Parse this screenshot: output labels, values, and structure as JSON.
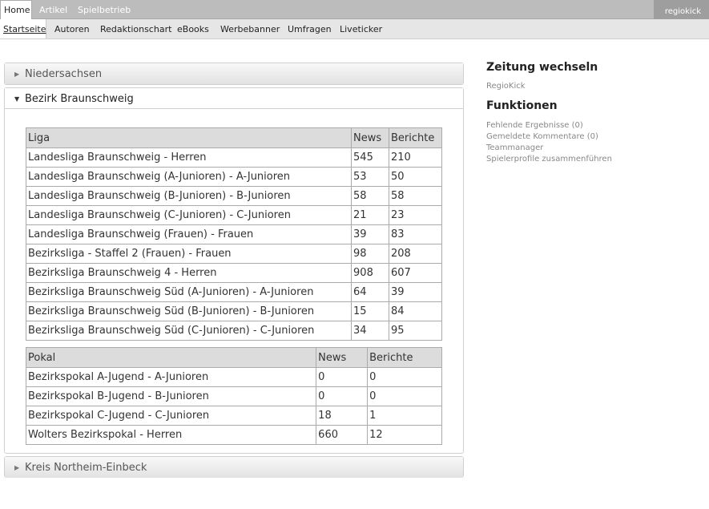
{
  "topnav": {
    "tabs": [
      {
        "label": "Home"
      },
      {
        "label": "Artikel"
      },
      {
        "label": "Spielbetrieb"
      }
    ],
    "user": "regiokick"
  },
  "subnav": {
    "items": [
      {
        "label": "Startseite"
      },
      {
        "label": "Autoren"
      },
      {
        "label": "Redaktionschart"
      },
      {
        "label": "eBooks"
      },
      {
        "label": "Werbebanner"
      },
      {
        "label": "Umfragen"
      },
      {
        "label": "Liveticker"
      }
    ]
  },
  "panels": {
    "niedersachsen": {
      "title": "Niedersachsen",
      "arrow": "▶"
    },
    "braunschweig": {
      "title": "Bezirk Braunschweig",
      "arrow": "▼"
    },
    "northeim": {
      "title": "Kreis Northeim-Einbeck",
      "arrow": "▶"
    }
  },
  "liga_table": {
    "headers": [
      "Liga",
      "News",
      "Berichte"
    ],
    "rows": [
      [
        "Landesliga Braunschweig - Herren",
        "545",
        "210"
      ],
      [
        "Landesliga Braunschweig (A-Junioren) - A-Junioren",
        "53",
        "50"
      ],
      [
        "Landesliga Braunschweig (B-Junioren) - B-Junioren",
        "58",
        "58"
      ],
      [
        "Landesliga Braunschweig (C-Junioren) - C-Junioren",
        "21",
        "23"
      ],
      [
        "Landesliga Braunschweig (Frauen) - Frauen",
        "39",
        "83"
      ],
      [
        "Bezirksliga - Staffel 2 (Frauen) - Frauen",
        "98",
        "208"
      ],
      [
        "Bezirksliga Braunschweig 4 - Herren",
        "908",
        "607"
      ],
      [
        "Bezirksliga Braunschweig Süd (A-Junioren) - A-Junioren",
        "64",
        "39"
      ],
      [
        "Bezirksliga Braunschweig Süd (B-Junioren) - B-Junioren",
        "15",
        "84"
      ],
      [
        "Bezirksliga Braunschweig Süd (C-Junioren) - C-Junioren",
        "34",
        "95"
      ]
    ]
  },
  "pokal_table": {
    "headers": [
      "Pokal",
      "News",
      "Berichte"
    ],
    "rows": [
      [
        "Bezirkspokal A-Jugend - A-Junioren",
        "0",
        "0"
      ],
      [
        "Bezirkspokal B-Jugend - B-Junioren",
        "0",
        "0"
      ],
      [
        "Bezirkspokal C-Jugend - C-Junioren",
        "18",
        "1"
      ],
      [
        "Wolters Bezirkspokal - Herren",
        "660",
        "12"
      ]
    ]
  },
  "sidebar": {
    "zeitung_title": "Zeitung wechseln",
    "zeitung_link": "RegioKick",
    "funktionen_title": "Funktionen",
    "links": [
      "Fehlende Ergebnisse (0)",
      "Gemeldete Kommentare (0)",
      "Teammanager",
      "Spielerprofile zusammenführen"
    ]
  }
}
